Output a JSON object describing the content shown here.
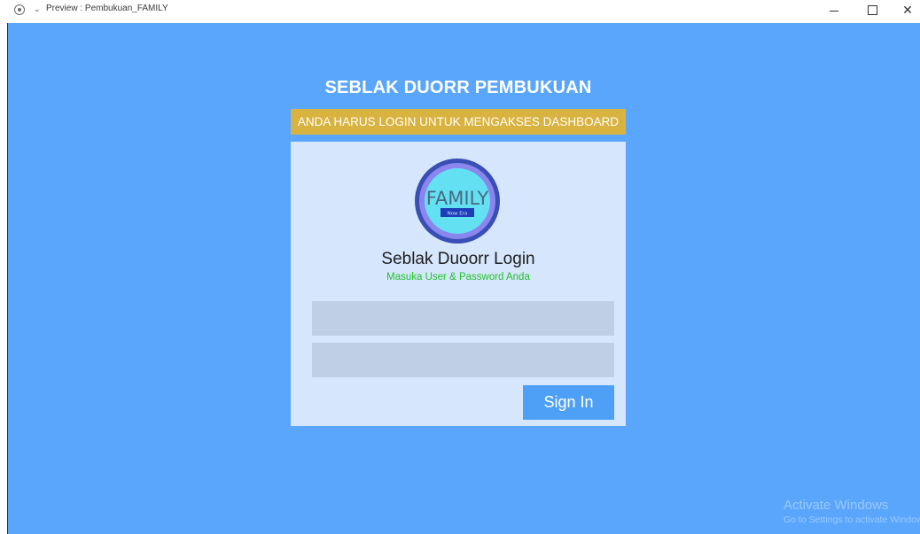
{
  "window": {
    "title": "Preview : Pembukuan_FAMILY",
    "controls": {
      "minimize_icon": "minimize-icon",
      "maximize_icon": "maximize-icon",
      "close_label": "✕"
    }
  },
  "app": {
    "title": "SEBLAK DUORR PEMBUKUAN",
    "banner": "ANDA HARUS LOGIN UNTUK MENGAKSES DASHBOARD"
  },
  "login": {
    "logo_text": "FAMILY",
    "logo_tag": "Now Era",
    "heading": "Seblak Duoorr Login",
    "subheading": "Masuka User & Password Anda",
    "username_value": "",
    "password_value": "",
    "signin_label": "Sign In"
  },
  "watermark": {
    "line1": "Activate Windows",
    "line2": "Go to Settings to activate Windows."
  },
  "colors": {
    "background": "#5ba6fd",
    "banner": "#d9b33f",
    "panel": "#d6e6fc",
    "field": "#bfcfe5",
    "button": "#4ea0f7",
    "subheading": "#22c22e"
  }
}
